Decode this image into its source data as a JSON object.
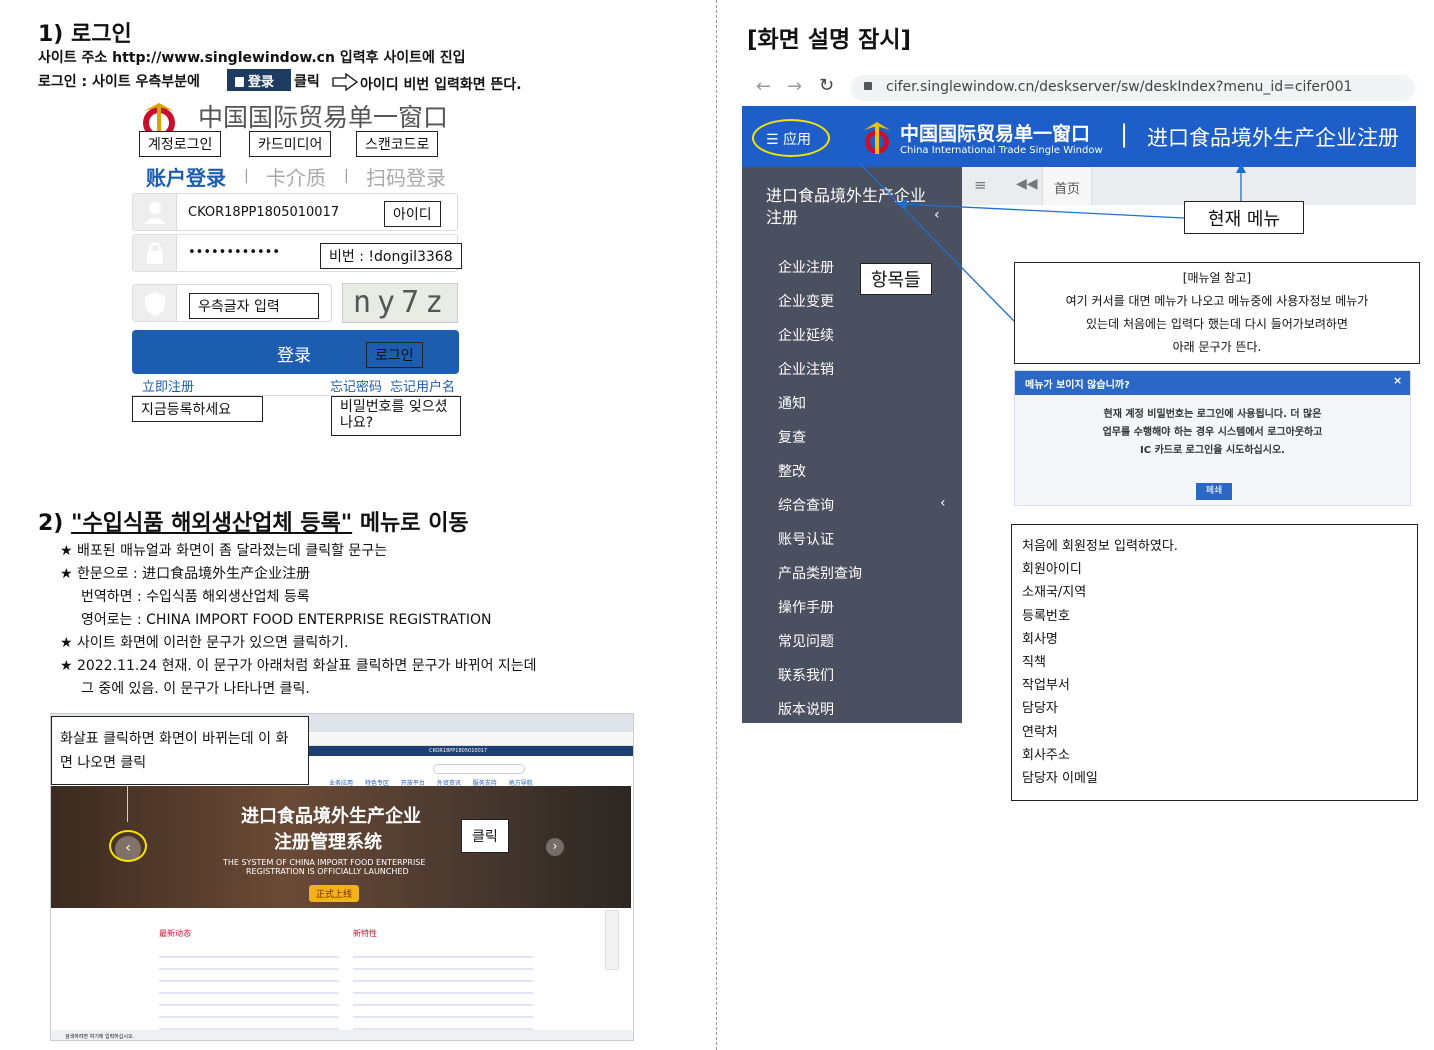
{
  "left": {
    "s1_title": "1) 로그인",
    "s1_line1": "사이트 주소 http://www.singlewindow.cn 입력후 사이트에 진입",
    "s1_line2a": "로그인 : 사이트 우측부분에",
    "s1_login_badge": "登录",
    "s1_line2b": "클릭",
    "s1_line2c": "아이디 비번 입력화면 뜬다.",
    "login": {
      "logo_text": "中国国际贸易单一窗口",
      "tab_account": "账户登录",
      "tab_card": "卡介质",
      "tab_scan": "扫码登录",
      "divider": "|",
      "lbl_account": "계정로그인",
      "lbl_card": "카드미디어",
      "lbl_scan": "스캔코드로",
      "username": "CKOR18PP1805010017",
      "lbl_id": "아이디",
      "password": "••••••••••••",
      "lbl_pw": "비번 : !dongil3368",
      "captcha_hint": "우측글자 입력",
      "captcha": "ny7z",
      "login_btn": "登录",
      "lbl_login": "로그인",
      "register_link": "立即注册",
      "forgot_pw": "忘记密码",
      "forgot_user": "忘记用户名",
      "lbl_register": "지금등록하세요",
      "lbl_forgot": "비밀번호를 잊으셨나요?"
    },
    "s2_title_num": "2) ",
    "s2_title_ul": "\"수입식품 해외생산업체 등록\"",
    "s2_title_rest": " 메뉴로 이동",
    "bullets": [
      "배포된 매뉴얼과 화면이 좀 달라졌는데 클릭할 문구는",
      "한문으로 : 进口食品境外生产企业注册",
      "사이트 화면에 이러한 문구가 있으면 클릭하기.",
      "2022.11.24 현재. 이 문구가 아래처럼 화살표 클릭하면 문구가 바뀌어 지는데"
    ],
    "bullet_sub1": "번역하면 : 수입식품 해외생산업체 등록",
    "bullet_sub2": "영어로는 : CHINA IMPORT FOOD ENTERPRISE REGISTRATION",
    "bullet_sub3": "그 중에 있음. 이 문구가 나타나면 클릭.",
    "star": "★",
    "shot": {
      "callout": "화살표 클릭하면 화면이 바뀌는데 이 화면 나오면 클릭",
      "banner_cn1": "进口食品境外生产企业",
      "banner_cn2": "注册管理系统",
      "banner_en1": "THE SYSTEM OF CHINA IMPORT FOOD ENTERPRISE",
      "banner_en2": "REGISTRATION IS OFFICIALLY LAUNCHED",
      "banner_btn": "正式上线",
      "click_label": "클릭",
      "news1": "最新动态",
      "news2": "新特性",
      "user": "CKOR18PP1805010017",
      "nav": [
        "业务应用",
        "特色专区",
        "开放平台",
        "外贸资讯",
        "服务支持",
        "地方导航"
      ],
      "taskbar_search": "검색하려면 여기에 입력하십시오."
    }
  },
  "right": {
    "title": "[화면 설명 잠시]",
    "url": "cifer.singlewindow.cn/deskserver/sw/deskIndex?menu_id=cifer001",
    "app_btn": "应用",
    "logo_cn": "中国国际贸易单一窗口",
    "logo_en": "China International Trade Single Window",
    "page_title": "进口食品境外生产企业注册",
    "bar_sep": "|",
    "cur_menu_label": "현재 메뉴",
    "side_heading": "进口食品境外生产企业注册",
    "items_label": "항목들",
    "tab_home": "首页",
    "menu": [
      "企业注册",
      "企业变更",
      "企业延续",
      "企业注销",
      "通知",
      "复查",
      "整改",
      "综合查询",
      "账号认证",
      "产品类别查询",
      "操作手册",
      "常见问题",
      "联系我们",
      "版本说明"
    ],
    "notice": {
      "l1": "[매뉴얼 참고]",
      "l2": "여기 커서를 대면 메뉴가 나오고 메뉴중에 사용자정보 메뉴가",
      "l3": "있는데 처음에는 입력다 했는데 다시 들어가보려하면",
      "l4": "아래 문구가 뜬다."
    },
    "dialog": {
      "title": "메뉴가 보이지 않습니까?",
      "close": "×",
      "b1": "현재 계정 비밀번호는 로그인에 사용됩니다. 더 많은",
      "b2": "업무를 수행해야 하는 경우 시스템에서 로그아웃하고",
      "b3": "IC 카드로 로그인을 시도하십시오.",
      "btn": "폐쇄"
    },
    "info": [
      "처음에 회원정보 입력하였다.",
      "회원아이디",
      "소재국/지역",
      "등록번호",
      "회사명",
      "직책",
      "작업부서",
      "담당자",
      "연락처",
      "회사주소",
      "담당자 이메일"
    ]
  }
}
